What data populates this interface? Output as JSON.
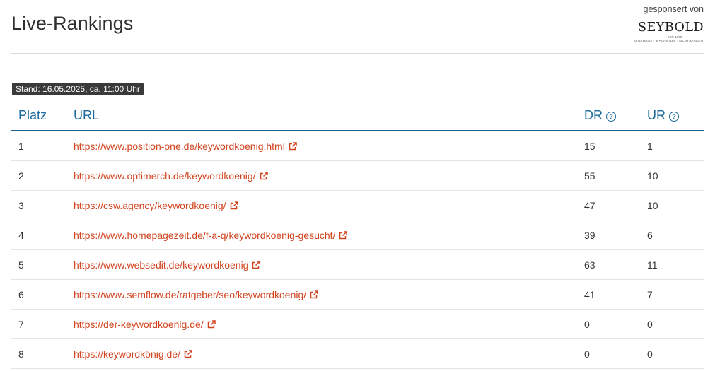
{
  "header": {
    "title": "Live-Rankings",
    "sponsor_text": "gesponsert von",
    "sponsor_logo_word": "SEYBOLD",
    "sponsor_logo_est": "EST. 1999",
    "sponsor_logo_tagline": "STRATEGIE · WACHSTUM · SICHTBARKEIT"
  },
  "stand": "Stand: 16.05.2025, ca. 11:00 Uhr",
  "table": {
    "columns": {
      "platz": "Platz",
      "url": "URL",
      "dr": "DR",
      "ur": "UR"
    },
    "rows": [
      {
        "platz": "1",
        "url": "https://www.position-one.de/keywordkoenig.html",
        "dr": "15",
        "ur": "1"
      },
      {
        "platz": "2",
        "url": "https://www.optimerch.de/keywordkoenig/",
        "dr": "55",
        "ur": "10"
      },
      {
        "platz": "3",
        "url": "https://csw.agency/keywordkoenig/",
        "dr": "47",
        "ur": "10"
      },
      {
        "platz": "4",
        "url": "https://www.homepagezeit.de/f-a-q/keywordkoenig-gesucht/",
        "dr": "39",
        "ur": "6"
      },
      {
        "platz": "5",
        "url": "https://www.websedit.de/keywordkoenig",
        "dr": "63",
        "ur": "11"
      },
      {
        "platz": "6",
        "url": "https://www.semflow.de/ratgeber/seo/keywordkoenig/",
        "dr": "41",
        "ur": "7"
      },
      {
        "platz": "7",
        "url": "https://der-keywordkoenig.de/",
        "dr": "0",
        "ur": "0"
      },
      {
        "platz": "8",
        "url": "https://keywordkönig.de/",
        "dr": "0",
        "ur": "0"
      }
    ]
  },
  "icons": {
    "help": "question-circle-icon",
    "external": "external-link-icon"
  },
  "colors": {
    "heading_blue": "#1d6a9c",
    "link_orange": "#d2431e",
    "badge_bg": "#3a3a3a"
  }
}
